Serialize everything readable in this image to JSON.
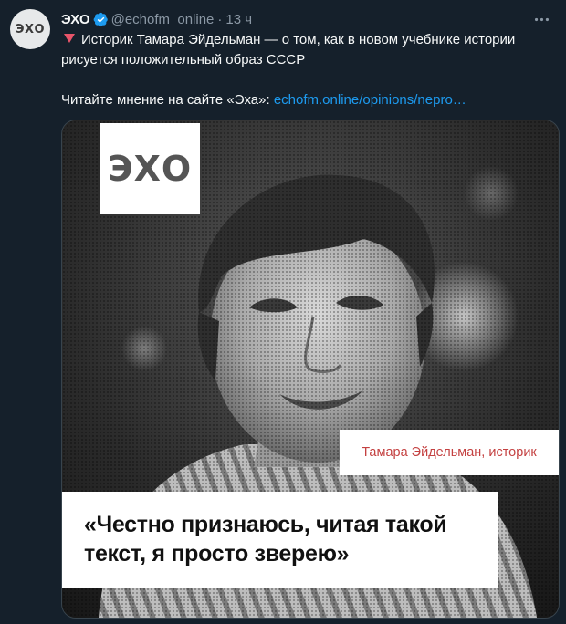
{
  "author": {
    "avatar_text": "ЭХО",
    "display_name": "ЭХО",
    "handle": "@echofm_online",
    "separator": "·",
    "time": "13 ч",
    "verified": true
  },
  "tweet": {
    "line1": "Историк Тамара Эйдельман — о том, как в новом учебнике истории рисуется положительный образ СССР",
    "line2_prefix": "Читайте мнение на сайте «Эха»: ",
    "link": "echofm.online/opinions/nepro…"
  },
  "media": {
    "logo_text": "ЭХО",
    "caption": "Тамара Эйдельман, историк",
    "quote": "«Честно признаюсь, читая такой текст, я просто зверею»"
  },
  "colors": {
    "background": "#15202b",
    "text": "#f7f9f9",
    "secondary": "#8b98a5",
    "link": "#1d9bf0",
    "verified": "#1d9bf0",
    "triangle": "#e8556a",
    "caption": "#c44141"
  },
  "icons": {
    "verified": "verified-badge-icon",
    "more": "more-dots-icon",
    "bullet": "red-triangle-icon"
  }
}
